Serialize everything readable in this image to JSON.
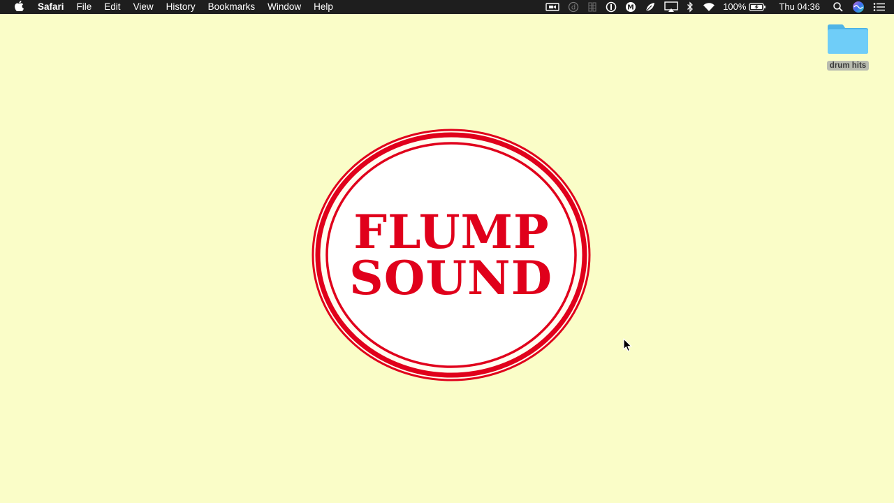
{
  "menubar": {
    "app_name": "Safari",
    "menus": [
      "File",
      "Edit",
      "View",
      "History",
      "Bookmarks",
      "Window",
      "Help"
    ],
    "status": {
      "battery_percent": "100%",
      "clock": "Thu 04:36"
    },
    "status_icons": [
      "screen-record-icon",
      "d-circle-icon",
      "stack-icon",
      "onepassword-icon",
      "m-circle-icon",
      "leaf-icon",
      "airplay-icon",
      "bluetooth-icon",
      "wifi-icon",
      "battery-icon",
      "spotlight-icon",
      "siri-icon",
      "notification-center-icon"
    ]
  },
  "desktop": {
    "folder_label": "drum hits",
    "folder_color": "#5ac4f5"
  },
  "logo": {
    "line1": "FLUMP",
    "line2": "SOUND",
    "color": "#e0001b"
  },
  "colors": {
    "desktop_background": "#fafdc8",
    "menubar_background": "#1e1e1e"
  }
}
